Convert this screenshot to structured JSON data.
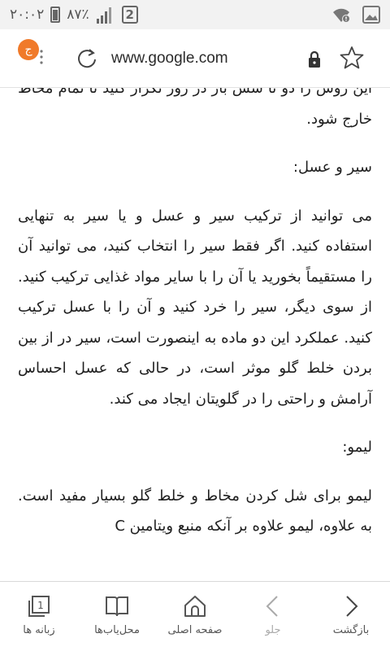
{
  "status_bar": {
    "time": "۲۰:۰۲",
    "battery": "۸۷٪",
    "sim": "2"
  },
  "address_bar": {
    "url": "www.google.com",
    "profile_letter": "ج"
  },
  "article": {
    "paragraphs": [
      "این روش را دو تا شش بار در روز تکرار کنید تا تمام مخاط خارج شود.",
      "سیر و عسل:",
      "می توانید از ترکیب سیر و عسل و یا سیر به تنهایی استفاده کنید. اگر فقط سیر را انتخاب کنید، می توانید آن را مستقیماً بخورید یا آن را با سایر مواد غذایی ترکیب کنید. از سوی دیگر، سیر را خرد کنید و آن را با عسل ترکیب کنید. عملکرد این دو ماده به اینصورت است، سیر در از بین بردن خلط گلو موثر است، در حالی که عسل احساس آرامش و راحتی را در گلویتان ایجاد می کند.",
      "لیمو:",
      "لیمو برای شل کردن مخاط و خلط گلو بسیار مفید است. به علاوه، لیمو علاوه بر آنکه منبع ویتامین C"
    ]
  },
  "toolbar": {
    "tabs_label": "زبانه ها",
    "tabs_count": "1",
    "bookmarks_label": "محل‌یاب‌ها",
    "home_label": "صفحه اصلی",
    "forward_label": "جلو",
    "back_label": "بازگشت"
  },
  "colors": {
    "accent": "#f07a2a",
    "icon": "#555555",
    "disabled": "#aaaaaa"
  }
}
